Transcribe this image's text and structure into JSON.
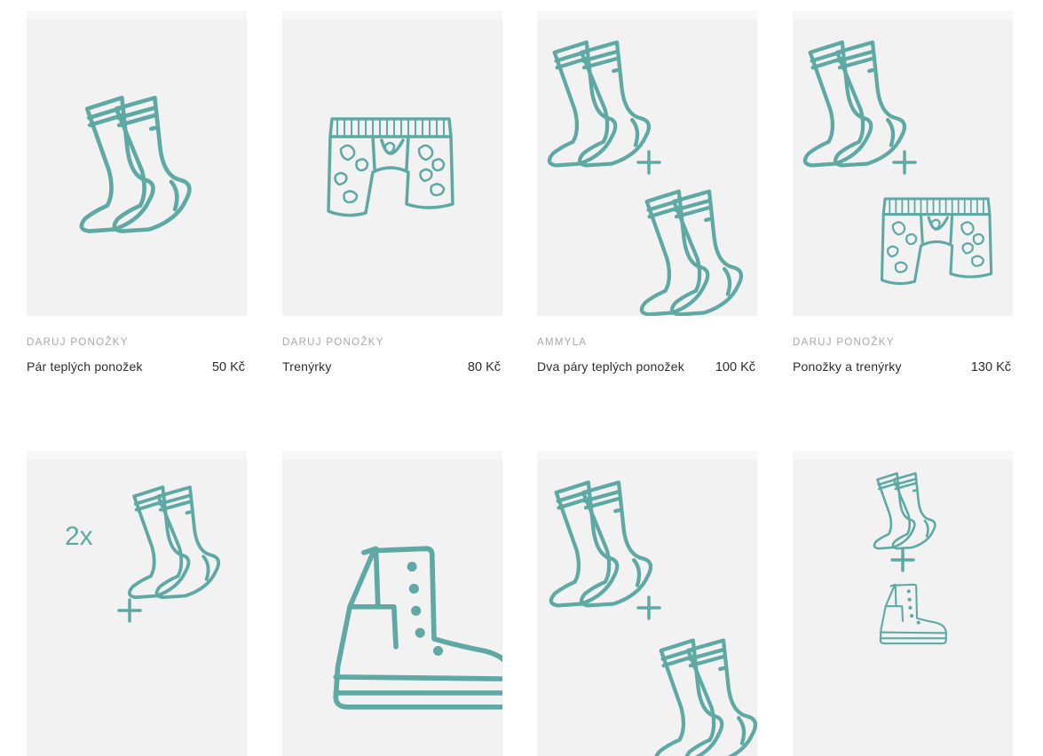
{
  "products": [
    {
      "vendor": "DARUJ PONOŽKY",
      "title": "Pár teplých ponožek",
      "price": "50 Kč",
      "icon": "socks-icon"
    },
    {
      "vendor": "DARUJ PONOŽKY",
      "title": "Trenýrky",
      "price": "80 Kč",
      "icon": "boxers-icon"
    },
    {
      "vendor": "AMMYLA",
      "title": "Dva páry teplých ponožek",
      "price": "100 Kč",
      "icon": "socks-plus-socks-icon"
    },
    {
      "vendor": "DARUJ PONOŽKY",
      "title": "Ponožky a trenýrky",
      "price": "130 Kč",
      "icon": "socks-plus-boxers-icon"
    },
    {
      "icon": "two-socks-plus-icon",
      "badge": "2x"
    },
    {
      "icon": "boot-icon"
    },
    {
      "icon": "socks-plus-icon"
    },
    {
      "icon": "socks-plus-boot-icon"
    }
  ],
  "colors": {
    "icon": "#5ea9a4",
    "tile": "#f2f2f2",
    "vendor": "#a7a7a7",
    "text": "#2d2d2d"
  }
}
